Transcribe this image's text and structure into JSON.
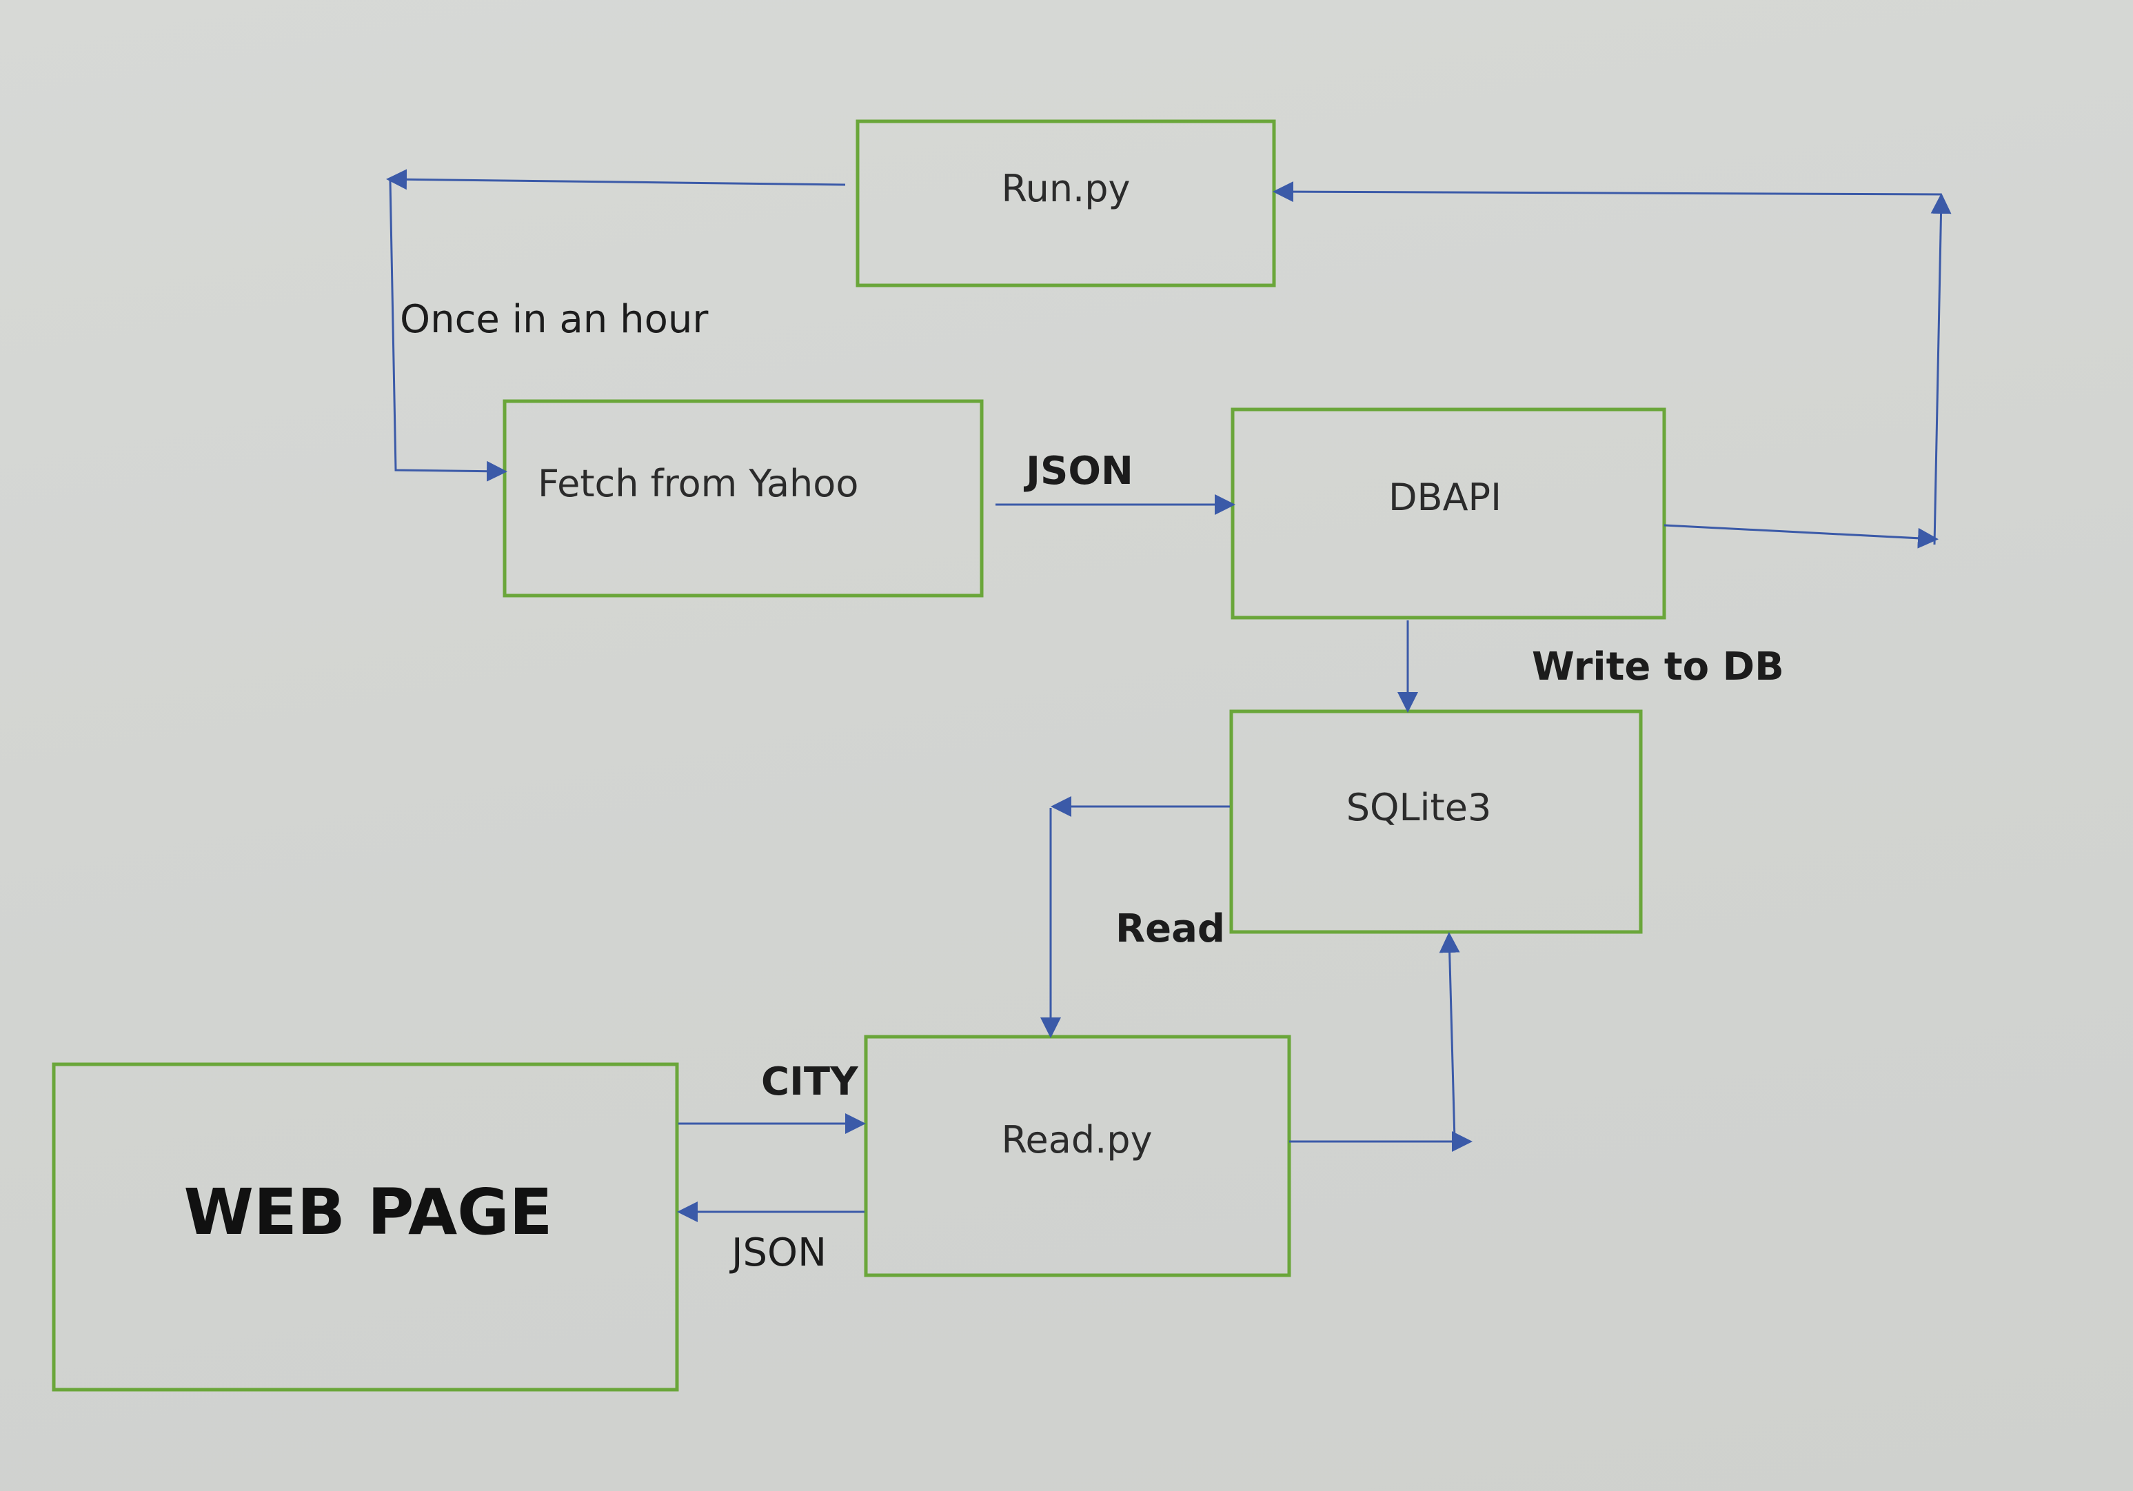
{
  "colors": {
    "background": "#d4d6d3",
    "box_border": "#6aa63a",
    "arrow": "#3b5aa8",
    "text": "#1c1c1c"
  },
  "nodes": {
    "run_py": "Run.py",
    "fetch": "Fetch from Yahoo",
    "dbapi": "DBAPI",
    "sqlite": "SQLite3",
    "read_py": "Read.py",
    "web_page": "WEB PAGE"
  },
  "edges": {
    "once_in_an_hour": "Once in an hour",
    "json_fetch_to_dbapi": "JSON",
    "write_to_db": "Write to DB",
    "read": "Read",
    "city": "CITY",
    "json_read_to_web": "JSON"
  }
}
